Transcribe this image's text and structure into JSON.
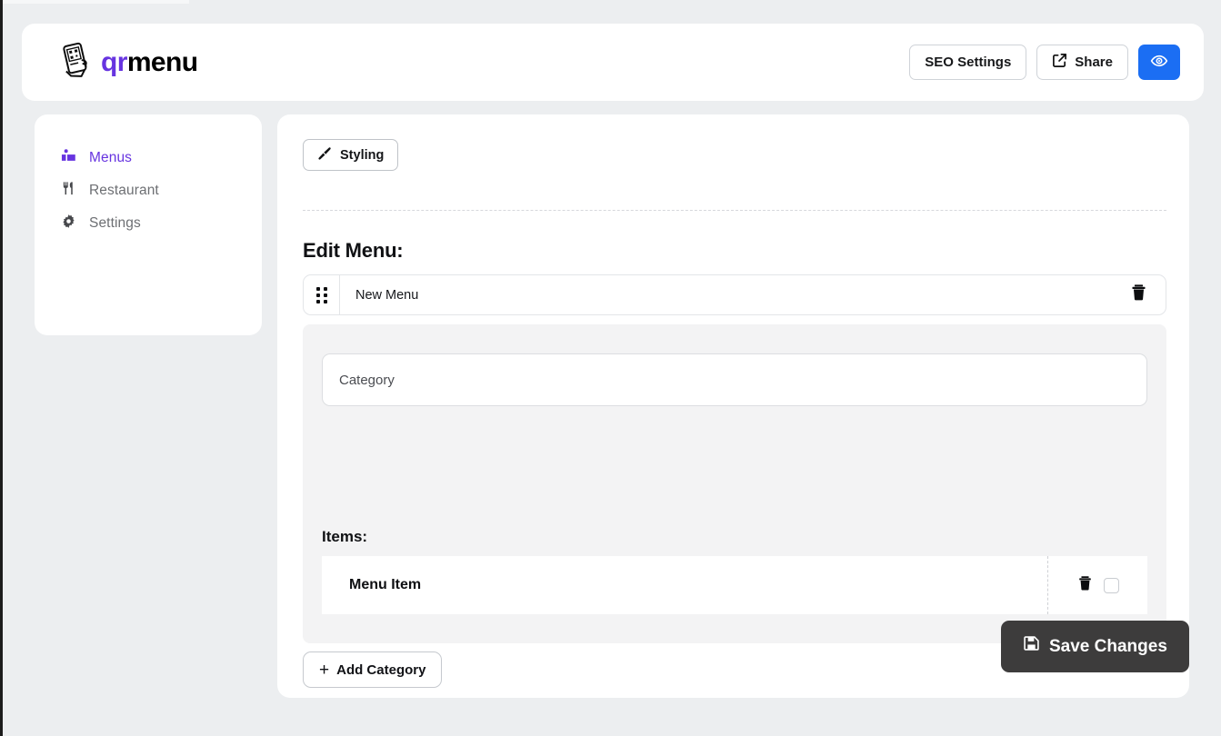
{
  "brand": {
    "qr": "qr",
    "menu": "menu",
    "logo_icon": "qr-phone-logo-icon"
  },
  "header": {
    "seo_label": "SEO Settings",
    "share_label": "Share",
    "share_icon": "external-link-icon",
    "preview_icon": "eye-icon",
    "preview_color": "#1b6ef3"
  },
  "sidebar": {
    "items": [
      {
        "label": "Menus",
        "icon": "book-users-icon",
        "active": true
      },
      {
        "label": "Restaurant",
        "icon": "fork-knife-icon",
        "active": false
      },
      {
        "label": "Settings",
        "icon": "gear-icon",
        "active": false
      }
    ],
    "active_color": "#6734e0"
  },
  "main": {
    "styling_label": "Styling",
    "styling_icon": "paintbrush-icon",
    "section_title": "Edit Menu:",
    "menu": {
      "drag_icon": "drag-handle-icon",
      "name": "New Menu",
      "delete_icon": "trash-icon"
    },
    "category": {
      "value": "Category",
      "placeholder": "Category",
      "items_label": "Items:",
      "items": [
        {
          "name": "Menu Item",
          "delete_icon": "trash-icon",
          "checked": false
        }
      ]
    },
    "add_category_label": "Add Category",
    "add_category_icon": "plus-icon",
    "save_label": "Save Changes",
    "save_icon": "save-floppy-icon"
  }
}
